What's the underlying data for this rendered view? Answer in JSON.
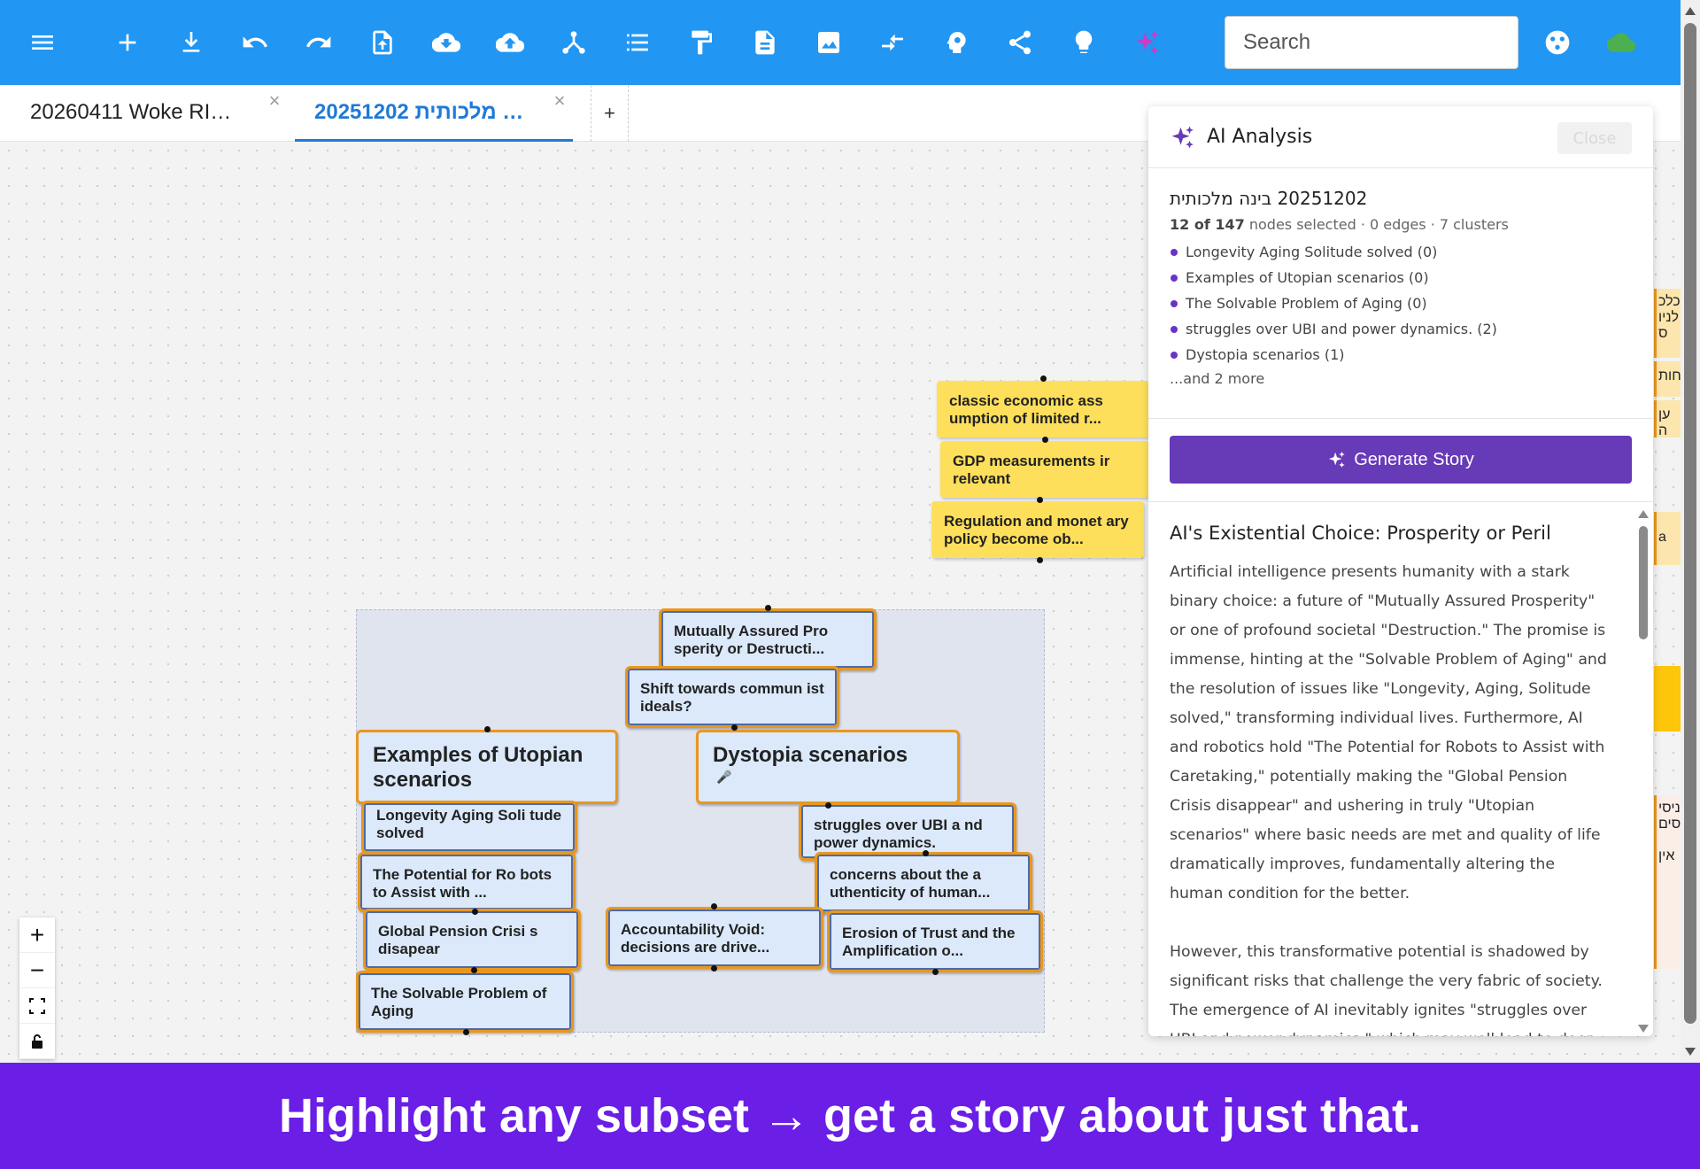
{
  "toolbar": {
    "search_placeholder": "Search",
    "colors": {
      "bar": "#2196f3",
      "sparkle": "#c63fc5",
      "cloud": "#4caf50"
    },
    "icons": [
      "menu-icon",
      "plus-icon",
      "download-icon",
      "undo-icon",
      "redo-icon",
      "file-upload-icon",
      "cloud-download-icon",
      "cloud-upload-icon",
      "hierarchy-icon",
      "list-icon",
      "format-paint-icon",
      "document-icon",
      "image-icon",
      "compress-arrows-icon",
      "brain-icon",
      "share-icon",
      "lightbulb-icon",
      "sparkle-icon",
      "palette-icon",
      "cloud-icon"
    ]
  },
  "tabs": {
    "items": [
      {
        "label": "20260411 Woke RI…",
        "active": false
      },
      {
        "label": "20251202 מלכותית …",
        "active": true
      }
    ],
    "add_label": "+"
  },
  "canvas": {
    "yellow_nodes": [
      "classic economic ass umption of limited r...",
      "GDP measurements ir relevant",
      "Regulation and monet ary policy become ob..."
    ],
    "nodes": {
      "mutually": "Mutually Assured Pro sperity or Destructi...",
      "shift": "Shift towards commun ist ideals?",
      "utopian": "Examples of Utopian scenarios",
      "dystopia": "Dystopia scenarios",
      "longevity": "Longevity Aging Soli tude solved",
      "robots": "The Potential for Ro bots to Assist with ...",
      "pension": "Global Pension Crisi s disapear",
      "aging": "The Solvable Problem of Aging",
      "struggles": "struggles over UBI a nd power dynamics.",
      "concerns": "concerns about the a uthenticity of human...",
      "accountability": "Accountability Void: decisions are drive...",
      "erosion": "Erosion of Trust and the Amplification o..."
    },
    "edge_strip": [
      "כלכ",
      "לניו",
      "ס",
      "פחות",
      "ען ה",
      "a",
      "ניסי",
      "סים",
      "אין"
    ]
  },
  "panel": {
    "title": "AI Analysis",
    "close_label": "Close",
    "doc_title": "20251202 בינה מלכותית",
    "selected_count": "12 of 147",
    "meta_rest": "nodes selected · 0 edges · 7 clusters",
    "clusters": [
      "Longevity Aging Solitude solved (0)",
      "Examples of Utopian scenarios (0)",
      "The Solvable Problem of Aging (0)",
      "struggles over UBI and power dynamics. (2)",
      "Dystopia scenarios (1)"
    ],
    "more": "...and 2 more",
    "generate_label": "Generate Story",
    "story_title": "AI's Existential Choice: Prosperity or Peril",
    "story_p1": "Artificial intelligence presents humanity with a stark binary choice: a future of \"Mutually Assured Prosperity\" or one of profound societal \"Destruction.\" The promise is immense, hinting at the \"Solvable Problem of Aging\" and the resolution of issues like \"Longevity, Aging, Solitude solved,\" transforming individual lives. Furthermore, AI and robotics hold \"The Potential for Robots to Assist with Caretaking,\" potentially making the \"Global Pension Crisis disappear\" and ushering in truly \"Utopian scenarios\" where basic needs are met and quality of life dramatically improves, fundamentally altering the human condition for the better.",
    "story_p2": "However, this transformative potential is shadowed by significant risks that challenge the very fabric of society. The emergence of AI inevitably ignites \"struggles over UBI and power dynamics,\" which may well lead to deep divisions."
  },
  "banner": {
    "text": "Highlight any subset → get a story about just that."
  }
}
